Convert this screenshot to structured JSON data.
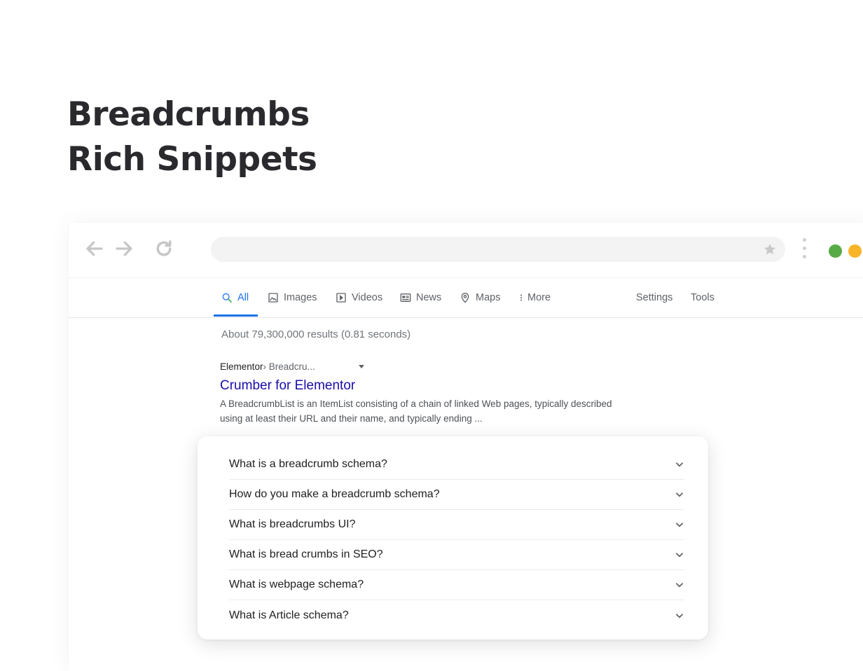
{
  "hero": {
    "line1": "Breadcrumbs",
    "line2": "Rich Snippets"
  },
  "browser": {
    "icons": [
      "back-arrow-icon",
      "forward-arrow-icon",
      "reload-icon",
      "star-icon",
      "kebab-menu-icon"
    ],
    "window_dots": [
      "#57ab46",
      "#f8b529"
    ]
  },
  "tabs": [
    {
      "label": "All",
      "icon": "search-icon",
      "active": true
    },
    {
      "label": "Images",
      "icon": "image-icon"
    },
    {
      "label": "Videos",
      "icon": "video-icon"
    },
    {
      "label": "News",
      "icon": "news-icon"
    },
    {
      "label": "Maps",
      "icon": "map-pin-icon"
    },
    {
      "label": "More",
      "icon": "more-vertical-icon"
    },
    {
      "label": "Settings"
    },
    {
      "label": "Tools"
    }
  ],
  "results": {
    "stats": "About 79,300,000 results (0.81 seconds)",
    "breadcrumb_site": "Elementor",
    "breadcrumb_path": " › Breadcru...",
    "title": "Crumber for Elementor",
    "snippet": "A BreadcrumbList is an ItemList consisting of a chain of linked Web pages, typically described using at least their URL and their name, and typically ending ..."
  },
  "faq": [
    "What is a breadcrumb schema?",
    "How do you make a breadcrumb schema?",
    "What is breadcrumbs UI?",
    "What is bread crumbs in SEO?",
    "What is webpage schema?",
    "What is Article schema?"
  ],
  "colors": {
    "accent": "#1a73e8",
    "link": "#1a0dab"
  }
}
